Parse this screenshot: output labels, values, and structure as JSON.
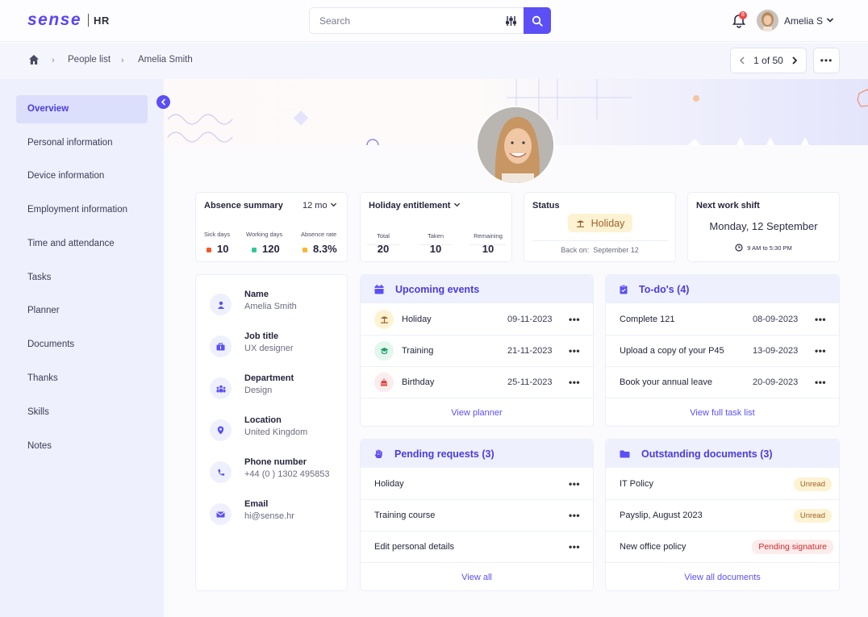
{
  "app": {
    "logo_text": "sense",
    "logo_suffix": "HR"
  },
  "search": {
    "placeholder": "Search"
  },
  "notifications": {
    "count": "8"
  },
  "user": {
    "name": "Amelia S"
  },
  "breadcrumb": {
    "items": [
      "People list",
      "Amelia Smith"
    ]
  },
  "pager": {
    "text": "1 of 50"
  },
  "sidebar": {
    "items": [
      {
        "label": "Overview",
        "active": true
      },
      {
        "label": "Personal information"
      },
      {
        "label": "Device information"
      },
      {
        "label": "Employment information"
      },
      {
        "label": "Time and attendance"
      },
      {
        "label": "Tasks"
      },
      {
        "label": "Planner"
      },
      {
        "label": "Documents"
      },
      {
        "label": "Thanks"
      },
      {
        "label": "Skills"
      },
      {
        "label": "Notes"
      }
    ]
  },
  "absence": {
    "title": "Absence summary",
    "period": "12 mo",
    "stats": [
      {
        "label": "Sick days",
        "value": "10",
        "color": "#f05a28"
      },
      {
        "label": "Working days",
        "value": "120",
        "color": "#2ecc8f"
      },
      {
        "label": "Absence rate",
        "value": "8.3%",
        "color": "#f7b733"
      }
    ]
  },
  "holiday": {
    "title": "Holiday entitlement",
    "stats": [
      {
        "label": "Total",
        "value": "20"
      },
      {
        "label": "Taken",
        "value": "10"
      },
      {
        "label": "Remaining",
        "value": "10"
      }
    ]
  },
  "status": {
    "title": "Status",
    "badge": "Holiday",
    "back_label": "Back on:",
    "back_date": "September 12"
  },
  "shift": {
    "title": "Next work shift",
    "date": "Monday, 12 September",
    "time": "9 AM to 5:30 PM"
  },
  "profile": {
    "fields": [
      {
        "label": "Name",
        "value": "Amelia Smith",
        "icon": "person-icon"
      },
      {
        "label": "Job title",
        "value": "UX designer",
        "icon": "briefcase-icon"
      },
      {
        "label": "Department",
        "value": "Design",
        "icon": "team-icon"
      },
      {
        "label": "Location",
        "value": "United Kingdom",
        "icon": "location-pin-icon"
      },
      {
        "label": "Phone number",
        "value": "+44 (0 ) 1302 495853",
        "icon": "phone-icon"
      },
      {
        "label": "Email",
        "value": "hi@sense.hr",
        "icon": "mail-icon"
      }
    ]
  },
  "events": {
    "title": "Upcoming events",
    "rows": [
      {
        "label": "Holiday",
        "date": "09-11-2023"
      },
      {
        "label": "Training",
        "date": "21-11-2023"
      },
      {
        "label": "Birthday",
        "date": "25-11-2023"
      }
    ],
    "link": "View planner"
  },
  "todos": {
    "title": "To-do's (4)",
    "rows": [
      {
        "label": "Complete 121",
        "date": "08-09-2023"
      },
      {
        "label": "Upload a copy of your P45",
        "date": "13-09-2023"
      },
      {
        "label": "Book your annual leave",
        "date": "20-09-2023"
      }
    ],
    "link": "View full task list"
  },
  "requests": {
    "title": "Pending requests (3)",
    "rows": [
      {
        "label": "Holiday"
      },
      {
        "label": "Training course"
      },
      {
        "label": "Edit personal details"
      }
    ],
    "link": "View all"
  },
  "documents": {
    "title": "Outstanding documents (3)",
    "rows": [
      {
        "label": "IT Policy",
        "tag": "Unread"
      },
      {
        "label": "Payslip, August 2023",
        "tag": "Unread"
      },
      {
        "label": "New office policy",
        "tag": "Pending signature"
      }
    ],
    "link": "View all documents"
  },
  "colors": {
    "accent": "#5b4ff5",
    "sidebar_bg": "#eff0fd",
    "unread_bg": "#fdf3d3",
    "pending_bg": "#fdecec"
  }
}
